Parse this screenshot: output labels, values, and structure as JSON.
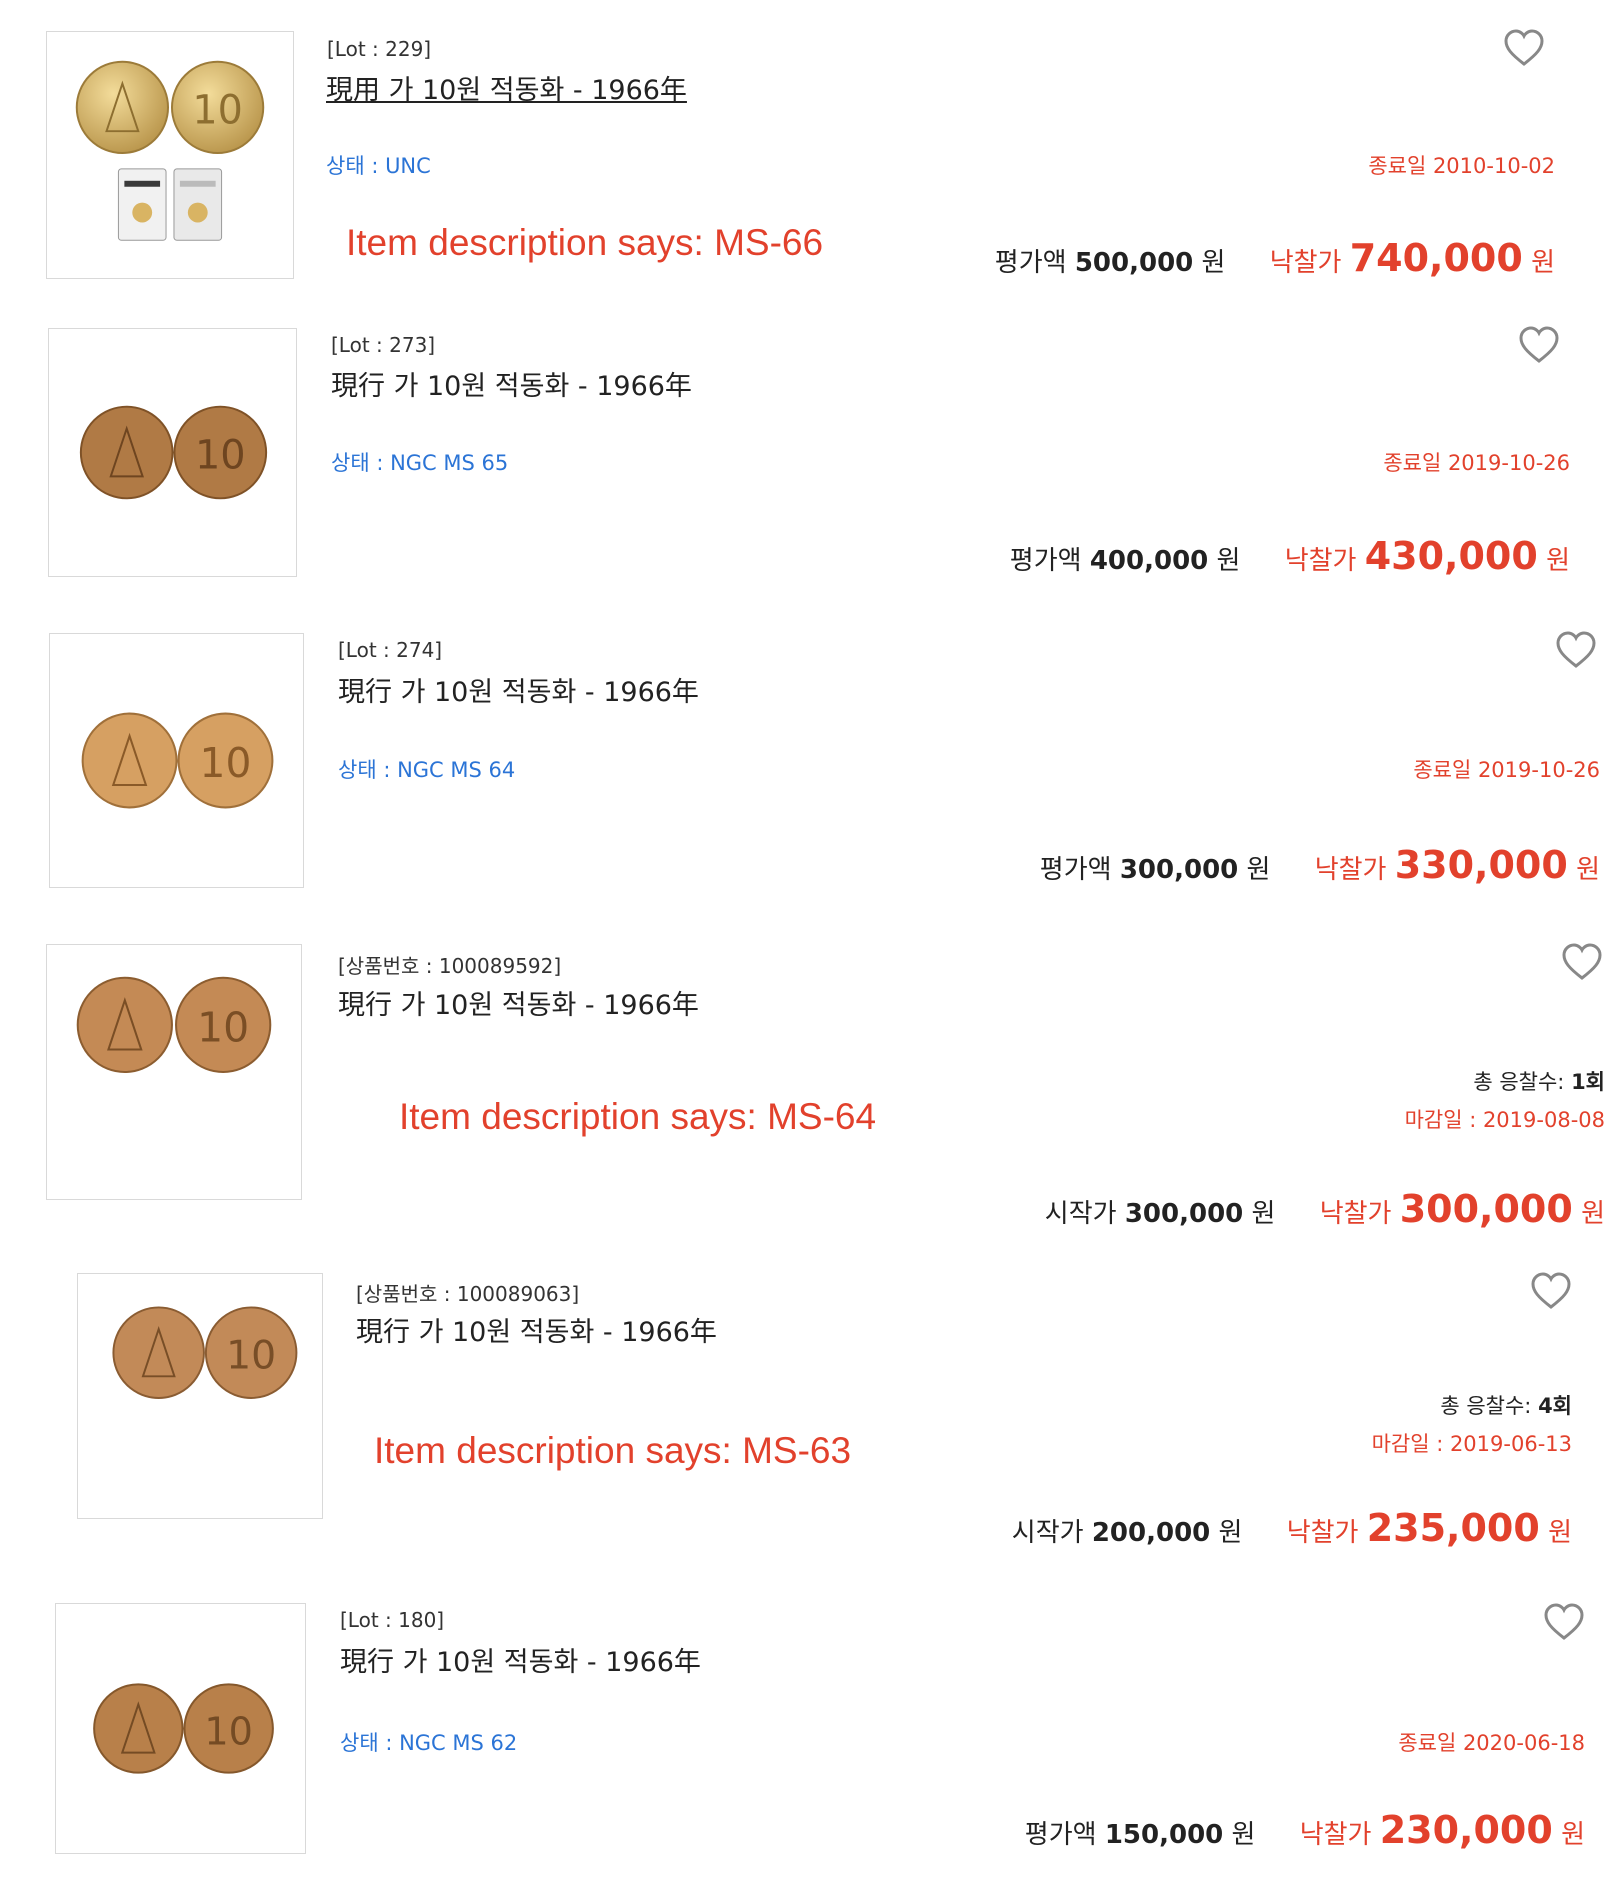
{
  "lots": [
    {
      "lot_no": "[Lot : 229]",
      "title": "現用 가 10원 적동화 - 1966年",
      "condition": "상태 : UNC",
      "note": "Item description says: MS-66",
      "end_date": "종료일 2010-10-02",
      "bids_label": "",
      "bids_value": "",
      "est_label": "평가액",
      "est_value": "500,000",
      "est_unit": "원",
      "sold_label": "낙찰가",
      "sold_value": "740,000",
      "sold_unit": "원",
      "has_slabs": true,
      "coin_color": "#d4b56a"
    },
    {
      "lot_no": "[Lot : 273]",
      "title": "現行 가 10원 적동화 - 1966年",
      "condition": "상태 : NGC MS 65",
      "note": "",
      "end_date": "종료일 2019-10-26",
      "bids_label": "",
      "bids_value": "",
      "est_label": "평가액",
      "est_value": "400,000",
      "est_unit": "원",
      "sold_label": "낙찰가",
      "sold_value": "430,000",
      "sold_unit": "원",
      "has_slabs": false,
      "coin_color": "#b07a45"
    },
    {
      "lot_no": "[Lot : 274]",
      "title": "現行 가 10원 적동화 - 1966年",
      "condition": "상태 : NGC MS 64",
      "note": "",
      "end_date": "종료일 2019-10-26",
      "bids_label": "",
      "bids_value": "",
      "est_label": "평가액",
      "est_value": "300,000",
      "est_unit": "원",
      "sold_label": "낙찰가",
      "sold_value": "330,000",
      "sold_unit": "원",
      "has_slabs": false,
      "coin_color": "#d6a062"
    },
    {
      "lot_no": "[상품번호 : 100089592]",
      "title": "現行 가 10원 적동화 - 1966年",
      "condition": "",
      "note": "Item description says: MS-64",
      "end_date": "마감일 : 2019-08-08",
      "bids_label": "총 응찰수:",
      "bids_value": "1회",
      "est_label": "시작가",
      "est_value": "300,000",
      "est_unit": "원",
      "sold_label": "낙찰가",
      "sold_value": "300,000",
      "sold_unit": "원",
      "has_slabs": false,
      "coin_color": "#c48a55"
    },
    {
      "lot_no": "[상품번호 : 100089063]",
      "title": "現行 가 10원 적동화 - 1966年",
      "condition": "",
      "note": "Item description says: MS-63",
      "end_date": "마감일 : 2019-06-13",
      "bids_label": "총 응찰수:",
      "bids_value": "4회",
      "est_label": "시작가",
      "est_value": "200,000",
      "est_unit": "원",
      "sold_label": "낙찰가",
      "sold_value": "235,000",
      "sold_unit": "원",
      "has_slabs": false,
      "coin_color": "#c28a58"
    },
    {
      "lot_no": "[Lot : 180]",
      "title": "現行 가 10원 적동화 - 1966年",
      "condition": "상태 : NGC MS 62",
      "note": "",
      "end_date": "종료일 2020-06-18",
      "bids_label": "",
      "bids_value": "",
      "est_label": "평가액",
      "est_value": "150,000",
      "est_unit": "원",
      "sold_label": "낙찰가",
      "sold_value": "230,000",
      "sold_unit": "원",
      "has_slabs": false,
      "coin_color": "#b8804a"
    }
  ],
  "icons": {
    "favorite": "heart-outline-icon"
  },
  "colors": {
    "accent_red": "#e2412c",
    "condition_blue": "#2b74d6",
    "text": "#222222"
  }
}
